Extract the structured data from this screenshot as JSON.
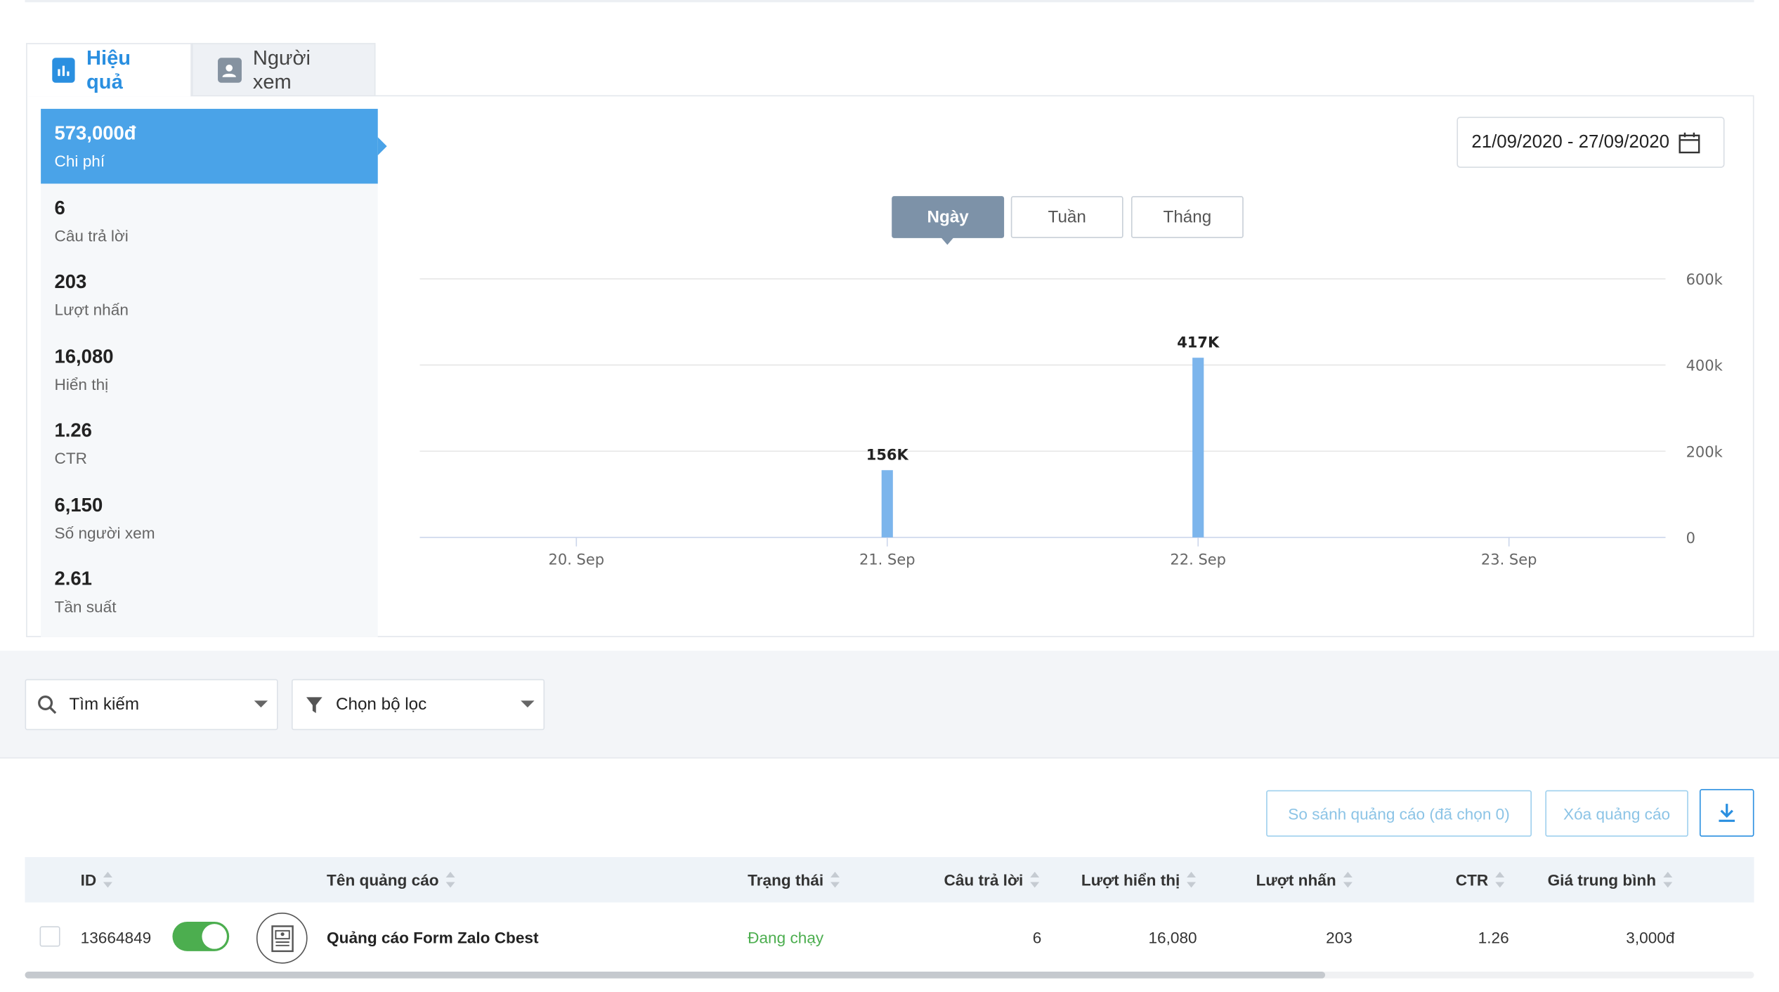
{
  "tabs": [
    {
      "label": "Hiệu quả",
      "icon": "bar-chart-icon",
      "active": true
    },
    {
      "label": "Người xem",
      "icon": "users-icon",
      "active": false
    }
  ],
  "metrics": [
    {
      "value": "573,000đ",
      "label": "Chi phí",
      "active": true
    },
    {
      "value": "6",
      "label": "Câu trả lời"
    },
    {
      "value": "203",
      "label": "Lượt nhấn"
    },
    {
      "value": "16,080",
      "label": "Hiển thị"
    },
    {
      "value": "1.26",
      "label": "CTR"
    },
    {
      "value": "6,150",
      "label": "Số người xem"
    },
    {
      "value": "2.61",
      "label": "Tần suất"
    }
  ],
  "date_range": "21/09/2020 - 27/09/2020",
  "granularity": {
    "options": [
      "Ngày",
      "Tuần",
      "Tháng"
    ],
    "selected": "Ngày"
  },
  "chart_data": {
    "type": "bar",
    "categories": [
      "20. Sep",
      "21. Sep",
      "22. Sep",
      "23. Sep"
    ],
    "values": [
      0,
      156000,
      417000,
      0
    ],
    "data_labels": [
      "",
      "156K",
      "417K",
      ""
    ],
    "y_ticks": [
      "0",
      "200k",
      "400k",
      "600k"
    ],
    "ylim": [
      0,
      600000
    ],
    "y_axis_side": "right",
    "grid": true,
    "bar_color": "#7cb5ec"
  },
  "filters": {
    "search_label": "Tìm kiếm",
    "filter_label": "Chọn bộ lọc"
  },
  "actions": {
    "compare_label": "So sánh quảng cáo (đã chọn 0)",
    "delete_label": "Xóa quảng cáo"
  },
  "table": {
    "columns": [
      "ID",
      "Tên quảng cáo",
      "Trạng thái",
      "Câu trả lời",
      "Lượt hiển thị",
      "Lượt nhấn",
      "CTR",
      "Giá trung bình"
    ],
    "rows": [
      {
        "id": "13664849",
        "enabled": true,
        "name": "Quảng cáo Form Zalo Cbest",
        "status": "Đang chạy",
        "status_color": "#4cae4f",
        "answers": "6",
        "impressions": "16,080",
        "clicks": "203",
        "ctr": "1.26",
        "avg_price": "3,000đ"
      }
    ]
  },
  "colors": {
    "accent": "#2a8fe0",
    "metric_active": "#4aa3e8",
    "segment_active": "#7d92a8"
  }
}
